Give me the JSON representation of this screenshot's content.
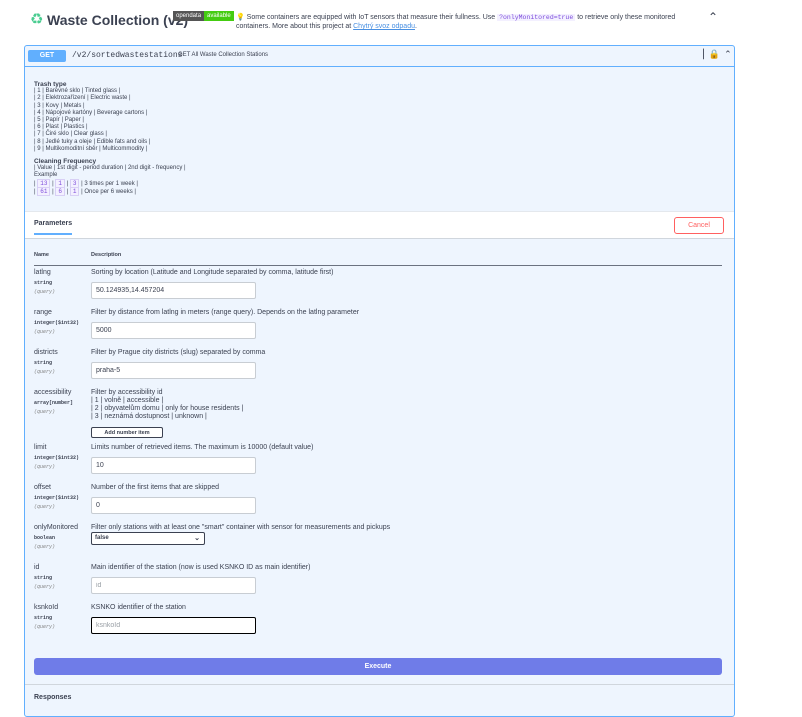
{
  "header": {
    "title": "Waste Collection (v2)",
    "badge_left": "opendata",
    "badge_right": "available",
    "desc_text": "Some containers are equipped with IoT sensors that measure their fullness. Use",
    "desc_code": "?onlyMonitored=true",
    "desc_text2": "to retrieve only these monitored containers. More about this project at",
    "desc_link": "Chytrý svoz odpadu",
    "desc_end": "."
  },
  "operation": {
    "method": "GET",
    "path": "/v2/sortedwastestations",
    "summary": "GET All Waste Collection Stations"
  },
  "description": {
    "trash_heading": "Trash type",
    "trash_lines": [
      "| 1 | Barevné sklo | Tinted glass |",
      "| 2 | Elektrozařízení | Electric waste |",
      "| 3 | Kovy | Metals |",
      "| 4 | Nápojové kartóny | Beverage cartons |",
      "| 5 | Papír | Paper |",
      "| 6 | Plast | Plastics |",
      "| 7 | Čiré sklo | Clear glass |",
      "| 8 | Jedlé tuky a oleje | Edible fats and oils |",
      "| 9 | Multikomoditní sběr | Multicommodity |"
    ],
    "cleaning_heading": "Cleaning Frequency",
    "cleaning_line": "| Value | 1st digit - period duration | 2nd digit - frequency |",
    "example_label": "Example",
    "example_rows": [
      {
        "value": "13",
        "d1": "1",
        "d2": "3",
        "text": "| 3 times per 1 week |"
      },
      {
        "value": "61",
        "d1": "6",
        "d2": "1",
        "text": "| Once per 6 weeks |"
      }
    ]
  },
  "params_tab": "Parameters",
  "cancel_label": "Cancel",
  "table": {
    "col_name": "Name",
    "col_desc": "Description"
  },
  "params": {
    "latlng": {
      "name": "latlng",
      "type": "string",
      "in": "(query)",
      "desc": "Sorting by location (Latitude and Longitude separated by comma, latitude first)",
      "value": "50.124935,14.457204"
    },
    "range": {
      "name": "range",
      "type": "integer($int32)",
      "in": "(query)",
      "desc": "Filter by distance from latlng in meters (range query). Depends on the latlng parameter",
      "value": "5000"
    },
    "districts": {
      "name": "districts",
      "type": "string",
      "in": "(query)",
      "desc": "Filter by Prague city districts (slug) separated by comma",
      "value": "praha-5"
    },
    "accessibility": {
      "name": "accessibility",
      "type": "array[number]",
      "in": "(query)",
      "desc_lines": [
        "Filter by accessibility id",
        "| 1 | volně | accessible |",
        "| 2 | obyvatelům domu | only for house residents |",
        "| 3 | neznámá dostupnost | unknown |"
      ],
      "add_label": "Add number item"
    },
    "limit": {
      "name": "limit",
      "type": "integer($int32)",
      "in": "(query)",
      "desc": "Limits number of retrieved items. The maximum is 10000 (default value)",
      "value": "10"
    },
    "offset": {
      "name": "offset",
      "type": "integer($int32)",
      "in": "(query)",
      "desc": "Number of the first items that are skipped",
      "value": "0"
    },
    "onlyMonitored": {
      "name": "onlyMonitored",
      "type": "boolean",
      "in": "(query)",
      "desc": "Filter only stations with at least one \"smart\" container with sensor for measurements and pickups",
      "value": "false"
    },
    "id": {
      "name": "id",
      "type": "string",
      "in": "(query)",
      "desc": "Main identifier of the station (now is used KSNKO ID as main identifier)",
      "placeholder": "id"
    },
    "ksnkoId": {
      "name": "ksnkoId",
      "type": "string",
      "in": "(query)",
      "desc": "KSNKO identifier of the station",
      "placeholder": "ksnkoId"
    }
  },
  "execute_label": "Execute",
  "responses_label": "Responses",
  "colors": {
    "get": "#61affe",
    "execute": "#6f7ce8",
    "cancel": "#ff6060"
  }
}
